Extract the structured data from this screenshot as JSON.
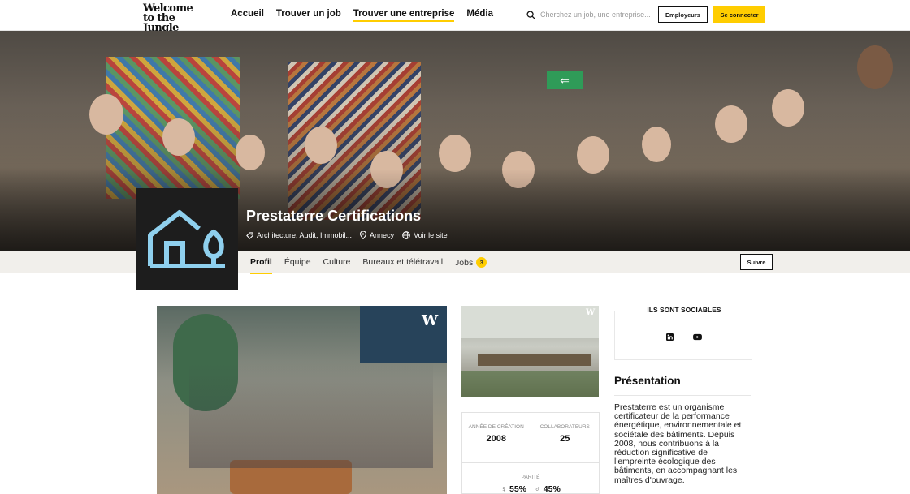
{
  "header": {
    "logo_line1": "Welcome",
    "logo_line2": "to the Jungle",
    "nav": [
      "Accueil",
      "Trouver un job",
      "Trouver une entreprise",
      "Média"
    ],
    "search_placeholder": "Cherchez un job, une entreprise...",
    "employers_label": "Employeurs",
    "login_label": "Se connecter",
    "accent_color": "#ffcd00"
  },
  "company": {
    "name": "Prestaterre Certifications",
    "sector": "Architecture, Audit, Immobil...",
    "location": "Annecy",
    "website_label": "Voir le site"
  },
  "tabs": [
    {
      "label": "Profil"
    },
    {
      "label": "Équipe"
    },
    {
      "label": "Culture"
    },
    {
      "label": "Bureaux et télétravail"
    },
    {
      "label": "Jobs",
      "count": "3"
    }
  ],
  "follow_label": "Suivre",
  "stats": {
    "creation_label": "Année de création",
    "creation_value": "2008",
    "staff_label": "Collaborateurs",
    "staff_value": "25",
    "parity_label": "Parité",
    "female_value": "55%",
    "male_value": "45%"
  },
  "social": {
    "title": "ILS SONT SOCIABLES",
    "icons": [
      "linkedin-icon",
      "youtube-icon"
    ]
  },
  "presentation": {
    "title": "Présentation",
    "text": "Prestaterre est un organisme certificateur de la performance énergétique, environnementale et sociétale des bâtiments. Depuis 2008, nous contribuons à la réduction significative de l'empreinte écologique des bâtiments, en accompagnant les maîtres d'ouvrage."
  }
}
